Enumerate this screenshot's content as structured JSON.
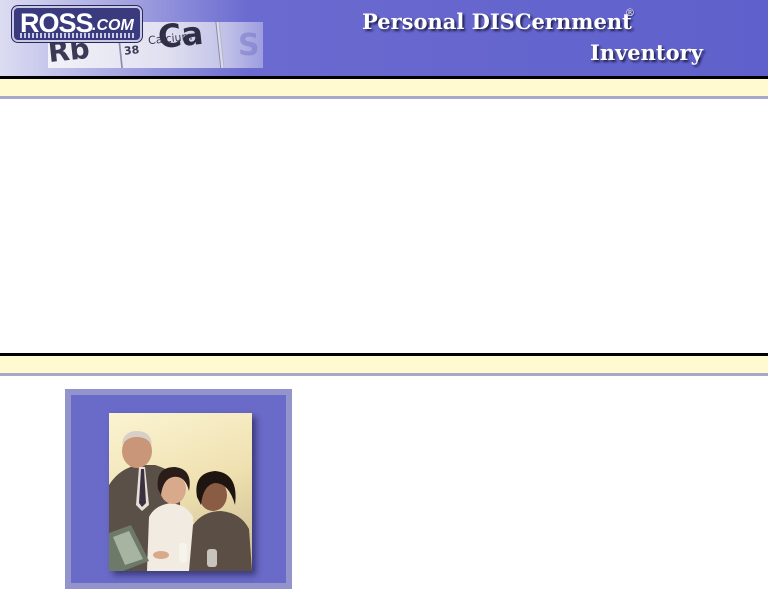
{
  "header": {
    "logo_main": "ROSS",
    "logo_suffix": ".COM",
    "title_line1": "Personal DISCernment",
    "title_line2": "Inventory",
    "registered_mark": "®",
    "background_elements": {
      "symbol_main": "Ca",
      "symbol_left": "Rb",
      "element_name": "Calcium",
      "atomic_number": "38",
      "symbol_right": "S"
    }
  },
  "photo": {
    "alt": "business people at a laptop"
  },
  "colors": {
    "header_purple": "#6060cc",
    "band_yellow": "#fffad0",
    "frame_lavender": "#9494cc",
    "frame_inner": "#6a6ac8"
  }
}
